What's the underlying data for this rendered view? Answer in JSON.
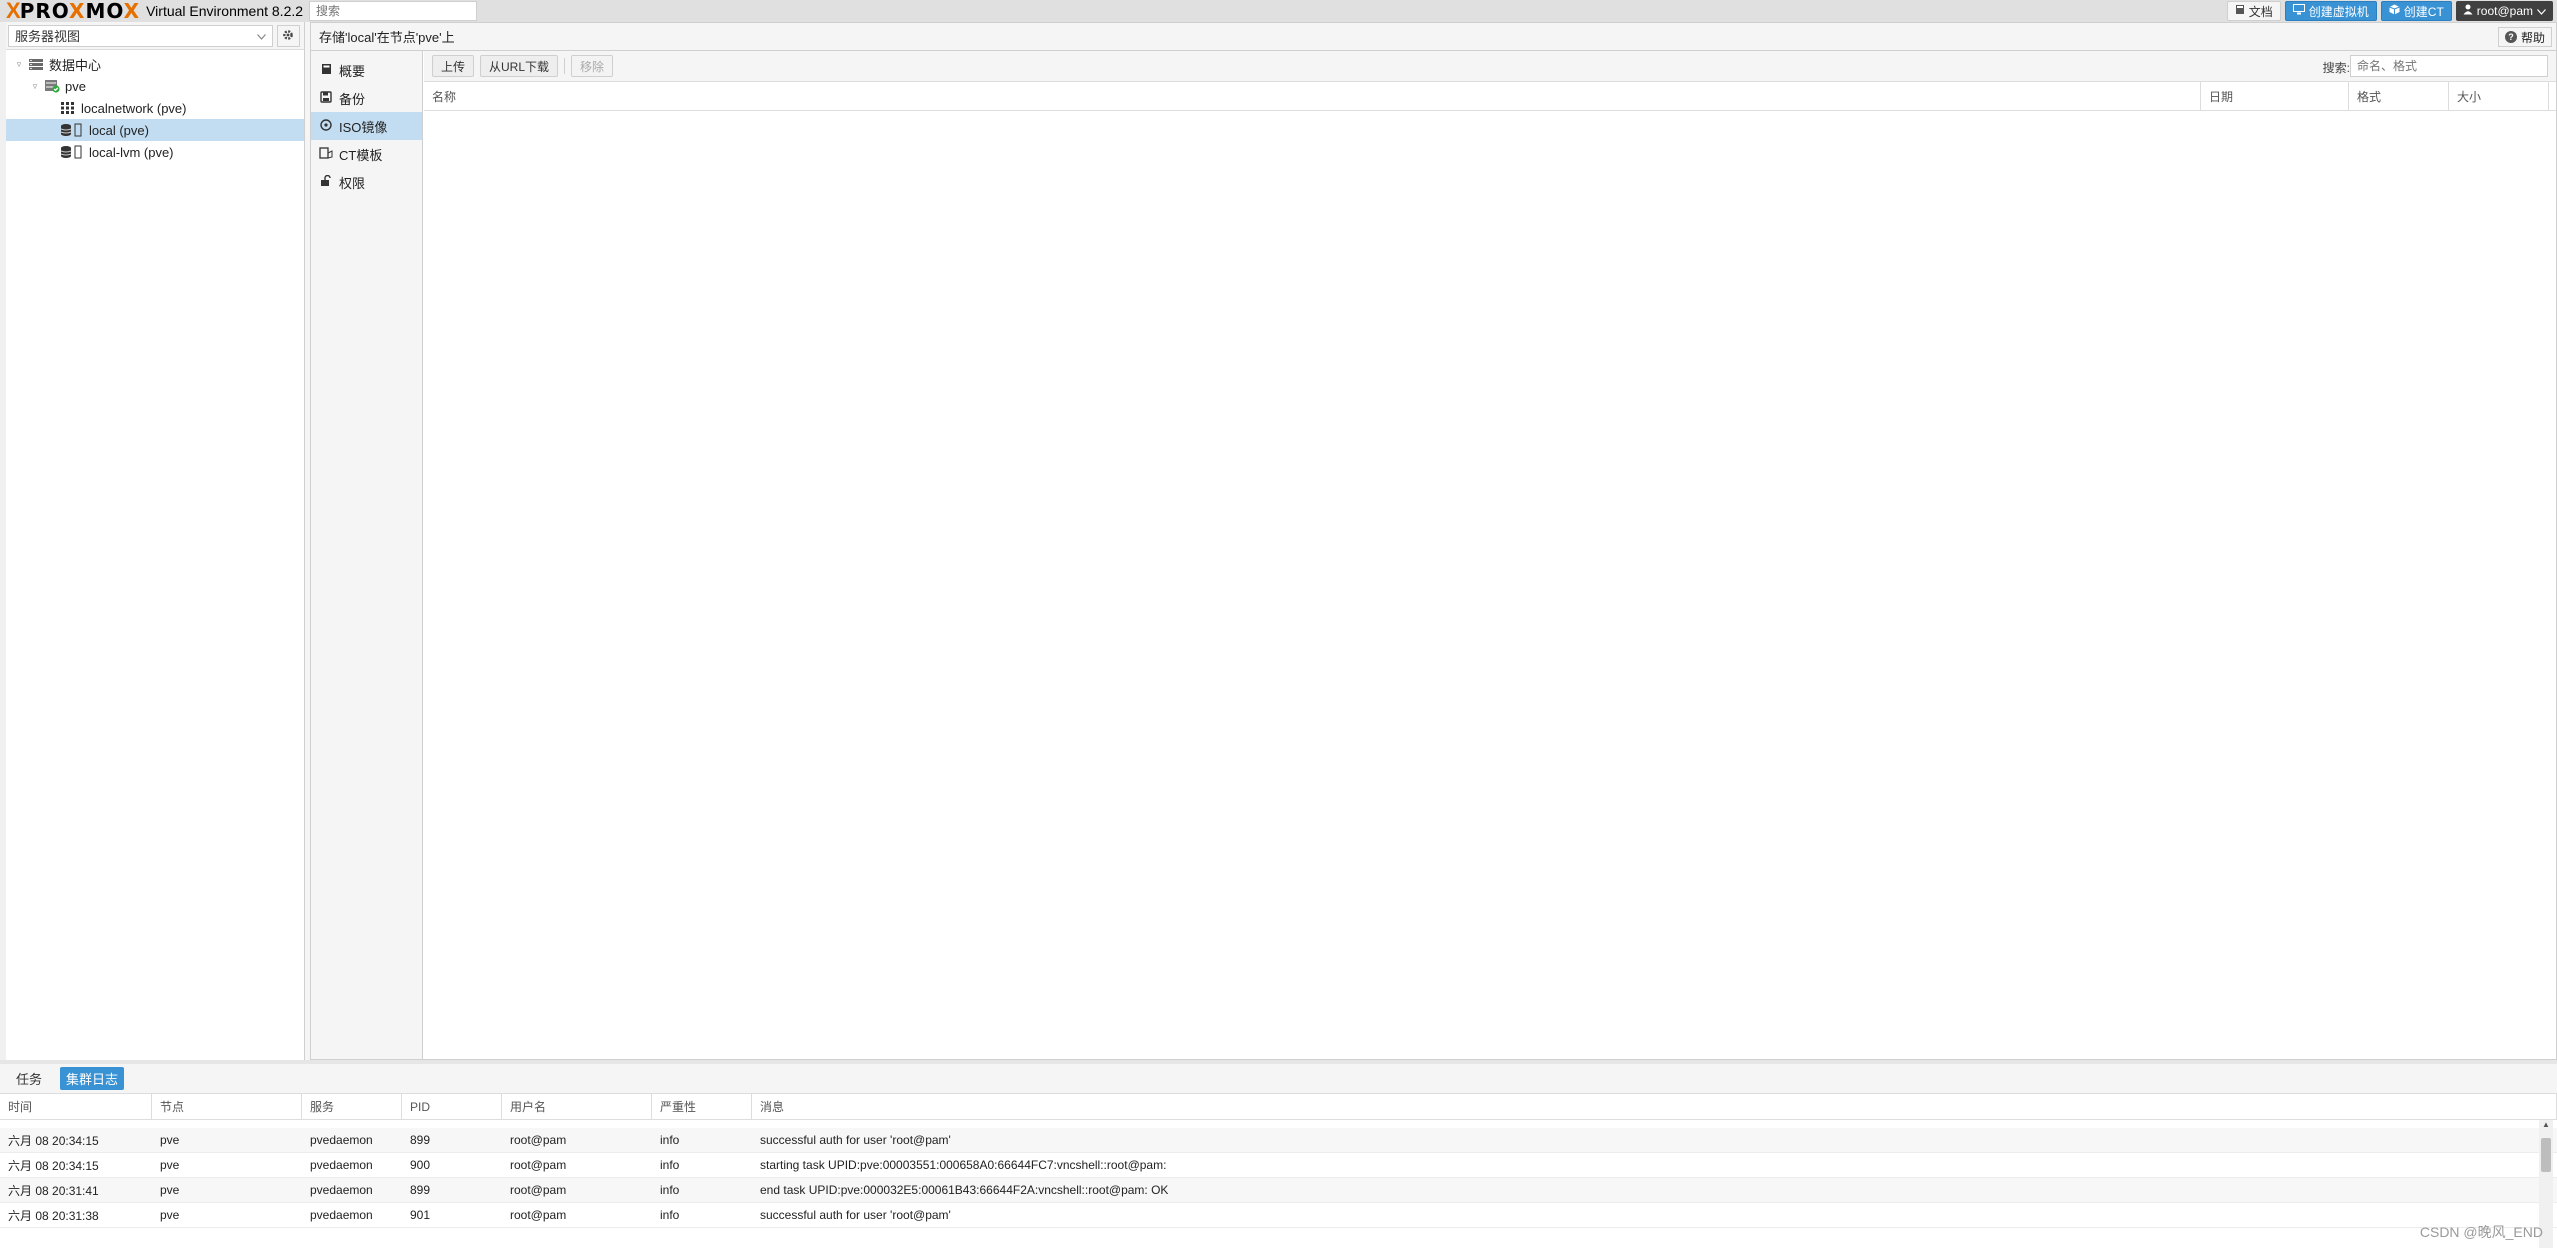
{
  "app": {
    "logo_x": "X",
    "logo_word_pre": "PRO",
    "logo_word_x": "X",
    "logo_word_mid": "MO",
    "logo_word_x2": "X",
    "version": "Virtual Environment 8.2.2",
    "search_placeholder": "搜索"
  },
  "top_buttons": {
    "docs": "文档",
    "create_vm": "创建虚拟机",
    "create_ct": "创建CT",
    "user": "root@pam"
  },
  "left": {
    "view_select": "服务器视图",
    "tree": [
      {
        "label": "数据中心",
        "level": 0,
        "icon": "datacenter-icon"
      },
      {
        "label": "pve",
        "level": 1,
        "icon": "node-icon"
      },
      {
        "label": "localnetwork (pve)",
        "level": 2,
        "icon": "network-icon"
      },
      {
        "label": "local (pve)",
        "level": 2,
        "icon": "storage-icon",
        "selected": true
      },
      {
        "label": "local-lvm (pve)",
        "level": 2,
        "icon": "storage-icon"
      }
    ]
  },
  "content": {
    "title": "存储'local'在节点'pve'上",
    "help": "帮助",
    "subnav": [
      {
        "label": "概要",
        "icon": "book-icon"
      },
      {
        "label": "备份",
        "icon": "floppy-icon"
      },
      {
        "label": "ISO镜像",
        "icon": "disc-icon",
        "selected": true
      },
      {
        "label": "CT模板",
        "icon": "template-icon"
      },
      {
        "label": "权限",
        "icon": "unlock-icon"
      }
    ],
    "toolbar": {
      "upload": "上传",
      "download_url": "从URL下载",
      "remove": "移除",
      "search_label": "搜索:",
      "search_placeholder": "命名、格式"
    },
    "columns": [
      "名称",
      "日期",
      "格式",
      "大小"
    ]
  },
  "bottom": {
    "tabs": [
      "任务",
      "集群日志"
    ],
    "active_tab": 1,
    "columns": [
      "时间",
      "节点",
      "服务",
      "PID",
      "用户名",
      "严重性",
      "消息"
    ],
    "rows": [
      {
        "time": "六月 08 20:34:15",
        "node": "pve",
        "service": "pvedaemon",
        "pid": "899",
        "user": "root@pam",
        "severity": "info",
        "message": "successful auth for user 'root@pam'"
      },
      {
        "time": "六月 08 20:34:15",
        "node": "pve",
        "service": "pvedaemon",
        "pid": "900",
        "user": "root@pam",
        "severity": "info",
        "message": "starting task UPID:pve:00003551:000658A0:66644FC7:vncshell::root@pam:"
      },
      {
        "time": "六月 08 20:31:41",
        "node": "pve",
        "service": "pvedaemon",
        "pid": "899",
        "user": "root@pam",
        "severity": "info",
        "message": "end task UPID:pve:000032E5:00061B43:66644F2A:vncshell::root@pam: OK"
      },
      {
        "time": "六月 08 20:31:38",
        "node": "pve",
        "service": "pvedaemon",
        "pid": "901",
        "user": "root@pam",
        "severity": "info",
        "message": "successful auth for user 'root@pam'"
      }
    ]
  },
  "watermark": "CSDN @晚风_END",
  "colors": {
    "accent": "#3892d4",
    "brand_orange": "#e57000",
    "selected": "#c2ddf2"
  }
}
